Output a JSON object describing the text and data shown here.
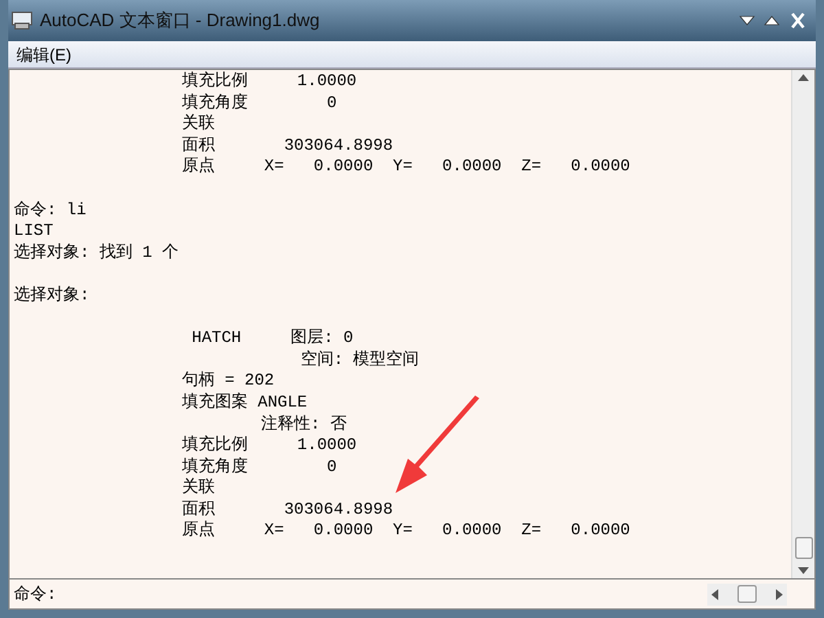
{
  "window": {
    "title": "AutoCAD 文本窗口 - Drawing1.dwg"
  },
  "menu": [
    {
      "label": "编辑(E)"
    }
  ],
  "history": [
    {
      "kind": "text",
      "text": "                 填充比例     1.0000"
    },
    {
      "kind": "text",
      "text": "                 填充角度        0"
    },
    {
      "kind": "text",
      "text": "                 关联"
    },
    {
      "kind": "text",
      "text": "                 面积       303064.8998"
    },
    {
      "kind": "text",
      "text": "                 原点     X=   0.0000  Y=   0.0000  Z=   0.0000"
    },
    {
      "kind": "blank"
    },
    {
      "kind": "text",
      "text": "命令: li"
    },
    {
      "kind": "text",
      "text": "LIST"
    },
    {
      "kind": "text",
      "text": "选择对象: 找到 1 个"
    },
    {
      "kind": "blank"
    },
    {
      "kind": "text",
      "text": "选择对象:"
    },
    {
      "kind": "blank"
    },
    {
      "kind": "text",
      "text": "                  HATCH     图层: 0"
    },
    {
      "kind": "text",
      "text": "                             空间: 模型空间"
    },
    {
      "kind": "text",
      "text": "                 句柄 = 202"
    },
    {
      "kind": "text",
      "text": "                 填充图案 ANGLE"
    },
    {
      "kind": "text",
      "text": "                         注释性: 否"
    },
    {
      "kind": "text",
      "text": "                 填充比例     1.0000"
    },
    {
      "kind": "text",
      "text": "                 填充角度        0"
    },
    {
      "kind": "text",
      "text": "                 关联"
    },
    {
      "kind": "text",
      "text": "                 面积       303064.8998"
    },
    {
      "kind": "text",
      "text": "                 原点     X=   0.0000  Y=   0.0000  Z=   0.0000"
    }
  ],
  "command_line": {
    "prompt": "命令:"
  }
}
